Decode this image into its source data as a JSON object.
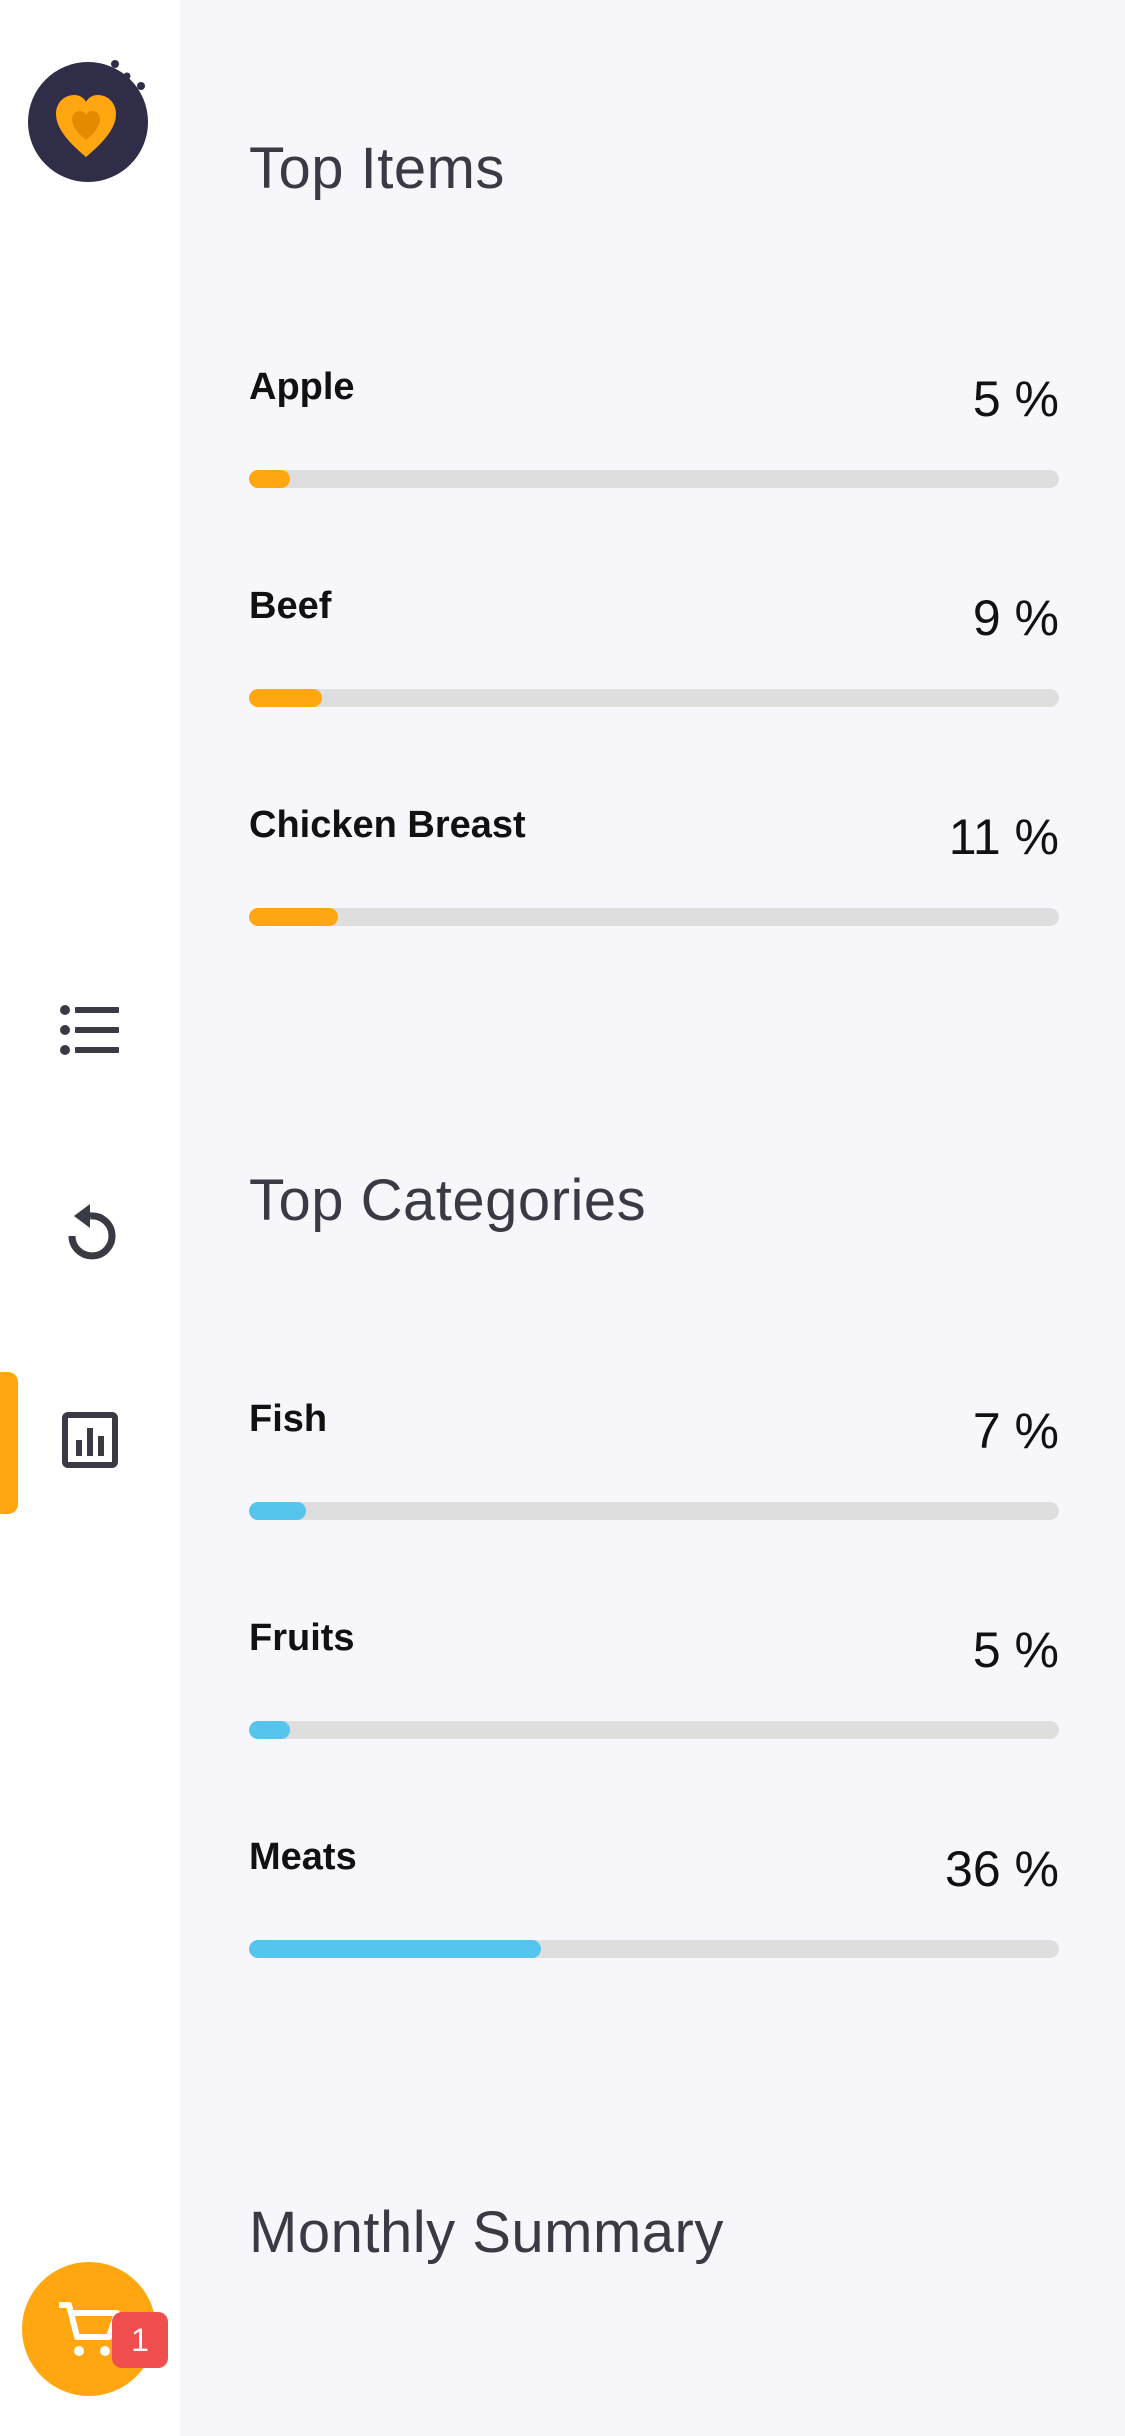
{
  "colors": {
    "accent": "#FFA611",
    "items_bar": "#FFA611",
    "categories_bar": "#55C5EE",
    "track": "#DEDEDE",
    "badge": "#F04E4E",
    "logo_bg": "#2F2D48"
  },
  "sidebar": {
    "logo_icon": "heart-cookie-logo",
    "nav": [
      {
        "icon": "list-icon",
        "active": false
      },
      {
        "icon": "history-icon",
        "active": false
      },
      {
        "icon": "bar-chart-icon",
        "active": true
      }
    ],
    "cart": {
      "icon": "cart-icon",
      "badge": "1"
    }
  },
  "top_items": {
    "title": "Top Items",
    "rows": [
      {
        "name": "Apple",
        "value_label": "5 %",
        "percent": 5
      },
      {
        "name": "Beef",
        "value_label": "9 %",
        "percent": 9
      },
      {
        "name": "Chicken Breast",
        "value_label": "11 %",
        "percent": 11
      }
    ]
  },
  "top_categories": {
    "title": "Top Categories",
    "rows": [
      {
        "name": "Fish",
        "value_label": "7 %",
        "percent": 7
      },
      {
        "name": "Fruits",
        "value_label": "5 %",
        "percent": 5
      },
      {
        "name": "Meats",
        "value_label": "36 %",
        "percent": 36
      }
    ]
  },
  "monthly_summary": {
    "title": "Monthly Summary"
  }
}
